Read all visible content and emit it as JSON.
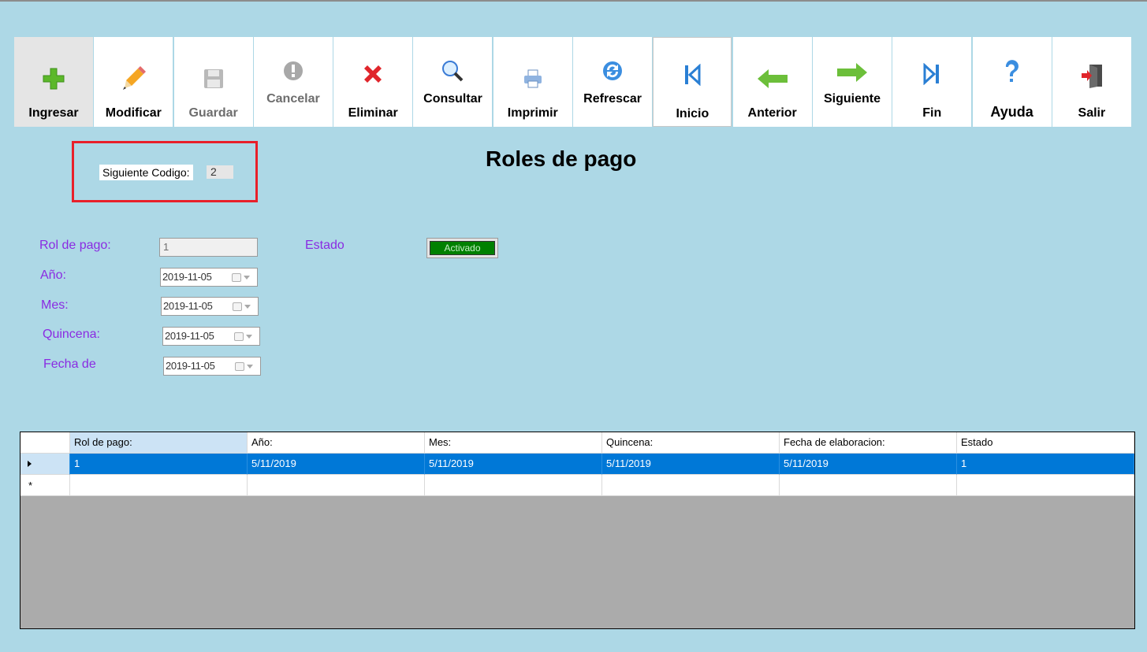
{
  "toolbar": [
    {
      "id": "ingresar",
      "label": "Ingresar",
      "icon": "plus-icon",
      "state": "active"
    },
    {
      "id": "modificar",
      "label": "Modificar",
      "icon": "pencil-icon",
      "state": "normal"
    },
    {
      "id": "guardar",
      "label": "Guardar",
      "icon": "save-icon",
      "state": "disabled"
    },
    {
      "id": "cancelar",
      "label": "Cancelar",
      "icon": "cancel-icon",
      "state": "disabled"
    },
    {
      "id": "eliminar",
      "label": "Eliminar",
      "icon": "delete-icon",
      "state": "normal"
    },
    {
      "id": "consultar",
      "label": "Consultar",
      "icon": "search-icon",
      "state": "normal"
    },
    {
      "id": "imprimir",
      "label": "Imprimir",
      "icon": "printer-icon",
      "state": "normal"
    },
    {
      "id": "refrescar",
      "label": "Refrescar",
      "icon": "refresh-icon",
      "state": "normal"
    },
    {
      "id": "inicio",
      "label": "Inicio",
      "icon": "first-record-icon",
      "state": "normal"
    },
    {
      "id": "anterior",
      "label": "Anterior",
      "icon": "arrow-left-icon",
      "state": "normal"
    },
    {
      "id": "siguiente",
      "label": "Siguiente",
      "icon": "arrow-right-icon",
      "state": "normal"
    },
    {
      "id": "fin",
      "label": "Fin",
      "icon": "last-record-icon",
      "state": "normal"
    },
    {
      "id": "ayuda",
      "label": "Ayuda",
      "icon": "help-icon",
      "state": "normal"
    },
    {
      "id": "salir",
      "label": "Salir",
      "icon": "exit-icon",
      "state": "normal"
    }
  ],
  "title": "Roles de pago",
  "siguiente_codigo": {
    "label": "Siguiente Codigo:",
    "value": "2"
  },
  "form": {
    "rol_label": "Rol de pago:",
    "rol_value": "1",
    "estado_label": "Estado",
    "estado_value": "Activado",
    "anio_label": "Año:",
    "anio_value": "2019-11-05",
    "mes_label": "Mes:",
    "mes_value": "2019-11-05",
    "quincena_label": "Quincena:",
    "quincena_value": "2019-11-05",
    "fecha_label": "Fecha de",
    "fecha_value": "2019-11-05"
  },
  "grid": {
    "headers": [
      "Rol de pago:",
      "Año:",
      "Mes:",
      "Quincena:",
      "Fecha de elaboracion:",
      "Estado"
    ],
    "rows": [
      [
        "1",
        "5/11/2019",
        "5/11/2019",
        "5/11/2019",
        "5/11/2019",
        "1"
      ]
    ]
  },
  "colors": {
    "background": "#add8e6",
    "label": "#8a2be2",
    "selection": "#0078d7",
    "status_on": "#008000"
  }
}
